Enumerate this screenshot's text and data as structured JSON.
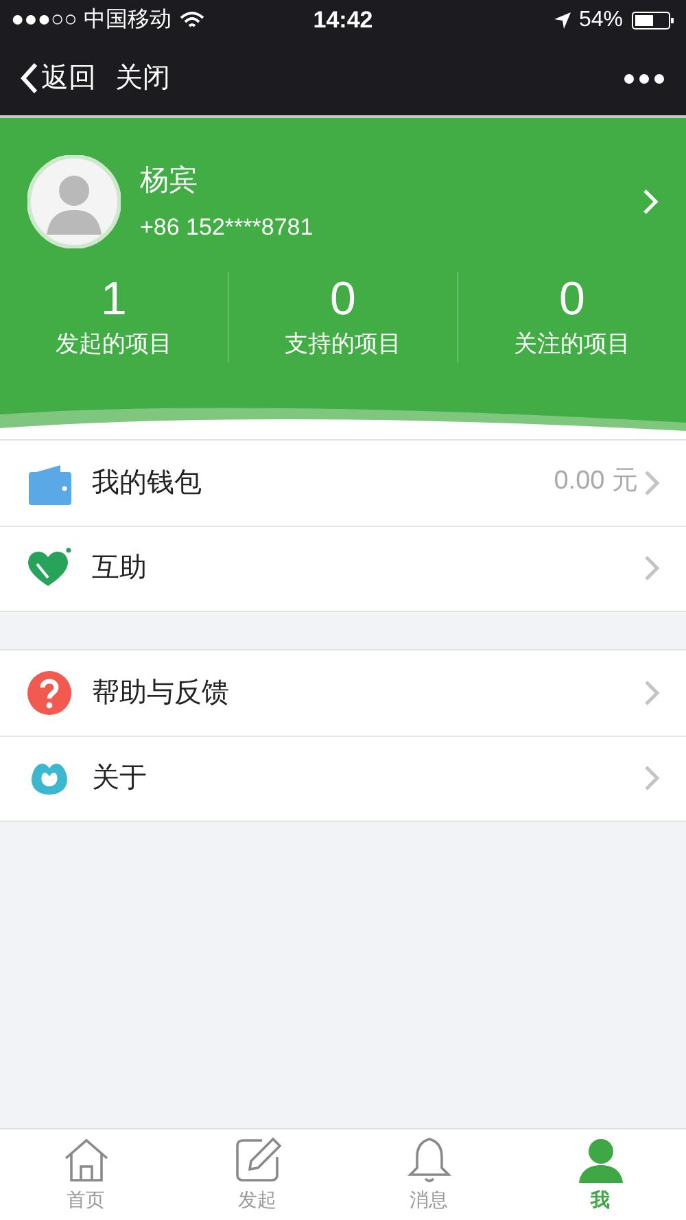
{
  "status_bar": {
    "carrier": "●●●○○ 中国移动",
    "time": "14:42",
    "battery": "54%"
  },
  "nav": {
    "back": "返回",
    "close": "关闭"
  },
  "profile": {
    "name": "杨宾",
    "phone": "+86 152****8781"
  },
  "stats": [
    {
      "value": "1",
      "label": "发起的项目"
    },
    {
      "value": "0",
      "label": "支持的项目"
    },
    {
      "value": "0",
      "label": "关注的项目"
    }
  ],
  "menu_groups": [
    [
      {
        "kind": "wallet",
        "label": "我的钱包",
        "value": "0.00 元"
      },
      {
        "kind": "heart",
        "label": "互助"
      }
    ],
    [
      {
        "kind": "help",
        "label": "帮助与反馈"
      },
      {
        "kind": "about",
        "label": "关于"
      }
    ]
  ],
  "tabs": [
    {
      "kind": "home",
      "label": "首页",
      "selected": false
    },
    {
      "kind": "edit",
      "label": "发起",
      "selected": false
    },
    {
      "kind": "bell",
      "label": "消息",
      "selected": false
    },
    {
      "kind": "person",
      "label": "我",
      "selected": true
    }
  ]
}
